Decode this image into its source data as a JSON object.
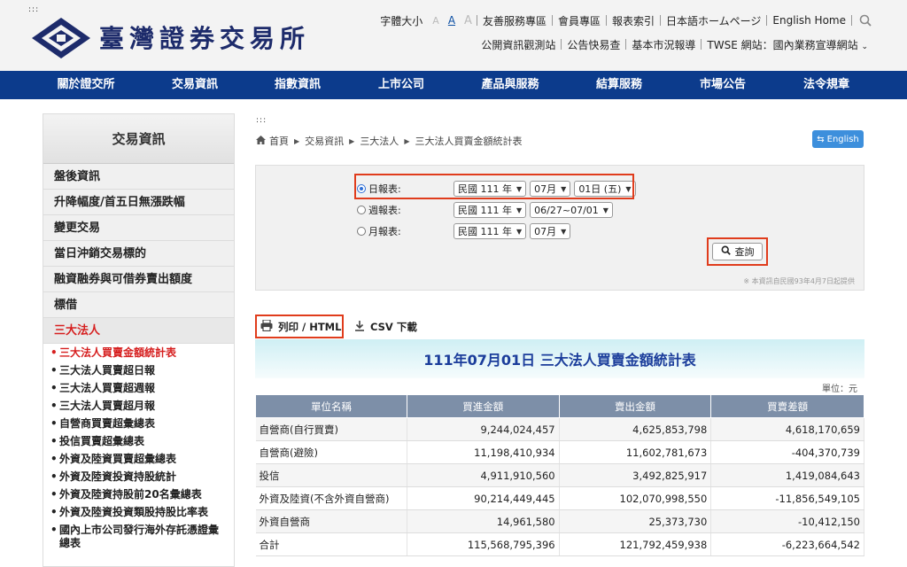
{
  "header": {
    "skip": ":::",
    "logo_text": "臺灣證券交易所",
    "font_size_label": "字體大小",
    "font_sizes": [
      "A",
      "A",
      "A"
    ],
    "top_links_1": [
      "友善服務專區",
      "會員專區",
      "報表索引",
      "日本語ホームページ",
      "English Home"
    ],
    "top_links_2": [
      "公開資訊觀測站",
      "公告快易查",
      "基本市況報導",
      "TWSE 網站：國內業務宣導網站"
    ]
  },
  "nav": [
    "關於證交所",
    "交易資訊",
    "指數資訊",
    "上市公司",
    "產品與服務",
    "結算服務",
    "市場公告",
    "法令規章"
  ],
  "sidebar": {
    "title": "交易資訊",
    "items": [
      "盤後資訊",
      "升降幅度/首五日無漲跌幅",
      "變更交易",
      "當日沖銷交易標的",
      "融資融券與可借券賣出額度",
      "標借",
      "三大法人"
    ],
    "sub_items": [
      "三大法人買賣金額統計表",
      "三大法人買賣超日報",
      "三大法人買賣超週報",
      "三大法人買賣超月報",
      "自營商買賣超彙總表",
      "投信買賣超彙總表",
      "外資及陸資買賣超彙總表",
      "外資及陸資投資持股統計",
      "外資及陸資持股前20名彙總表",
      "外資及陸資投資類股持股比率表",
      "國內上市公司發行海外存託憑證彙總表"
    ]
  },
  "content": {
    "skip": ":::",
    "breadcrumb": [
      "首頁",
      "交易資訊",
      "三大法人",
      "三大法人買賣金額統計表"
    ],
    "english_button": "English",
    "form": {
      "daily_label": "日報表:",
      "weekly_label": "週報表:",
      "monthly_label": "月報表:",
      "daily_year": "民國 111 年",
      "daily_month": "07月",
      "daily_day": "01日 (五)",
      "weekly_year": "民國 111 年",
      "weekly_range": "06/27~07/01",
      "monthly_year": "民國 111 年",
      "monthly_month": "07月",
      "query_button": "查詢",
      "note": "※ 本資訊自民國93年4月7日起提供"
    },
    "print_label": "列印 / HTML",
    "csv_label": "CSV 下載",
    "report_title": "111年07月01日 三大法人買賣金額統計表",
    "unit": "單位：元",
    "table": {
      "headers": [
        "單位名稱",
        "買進金額",
        "賣出金額",
        "買賣差額"
      ],
      "rows": [
        [
          "自營商(自行買賣)",
          "9,244,024,457",
          "4,625,853,798",
          "4,618,170,659"
        ],
        [
          "自營商(避險)",
          "11,198,410,934",
          "11,602,781,673",
          "-404,370,739"
        ],
        [
          "投信",
          "4,911,910,560",
          "3,492,825,917",
          "1,419,084,643"
        ],
        [
          "外資及陸資(不含外資自營商)",
          "90,214,449,445",
          "102,070,998,550",
          "-11,856,549,105"
        ],
        [
          "外資自營商",
          "14,961,580",
          "25,373,730",
          "-10,412,150"
        ],
        [
          "合計",
          "115,568,795,396",
          "121,792,459,938",
          "-6,223,664,542"
        ]
      ]
    }
  }
}
